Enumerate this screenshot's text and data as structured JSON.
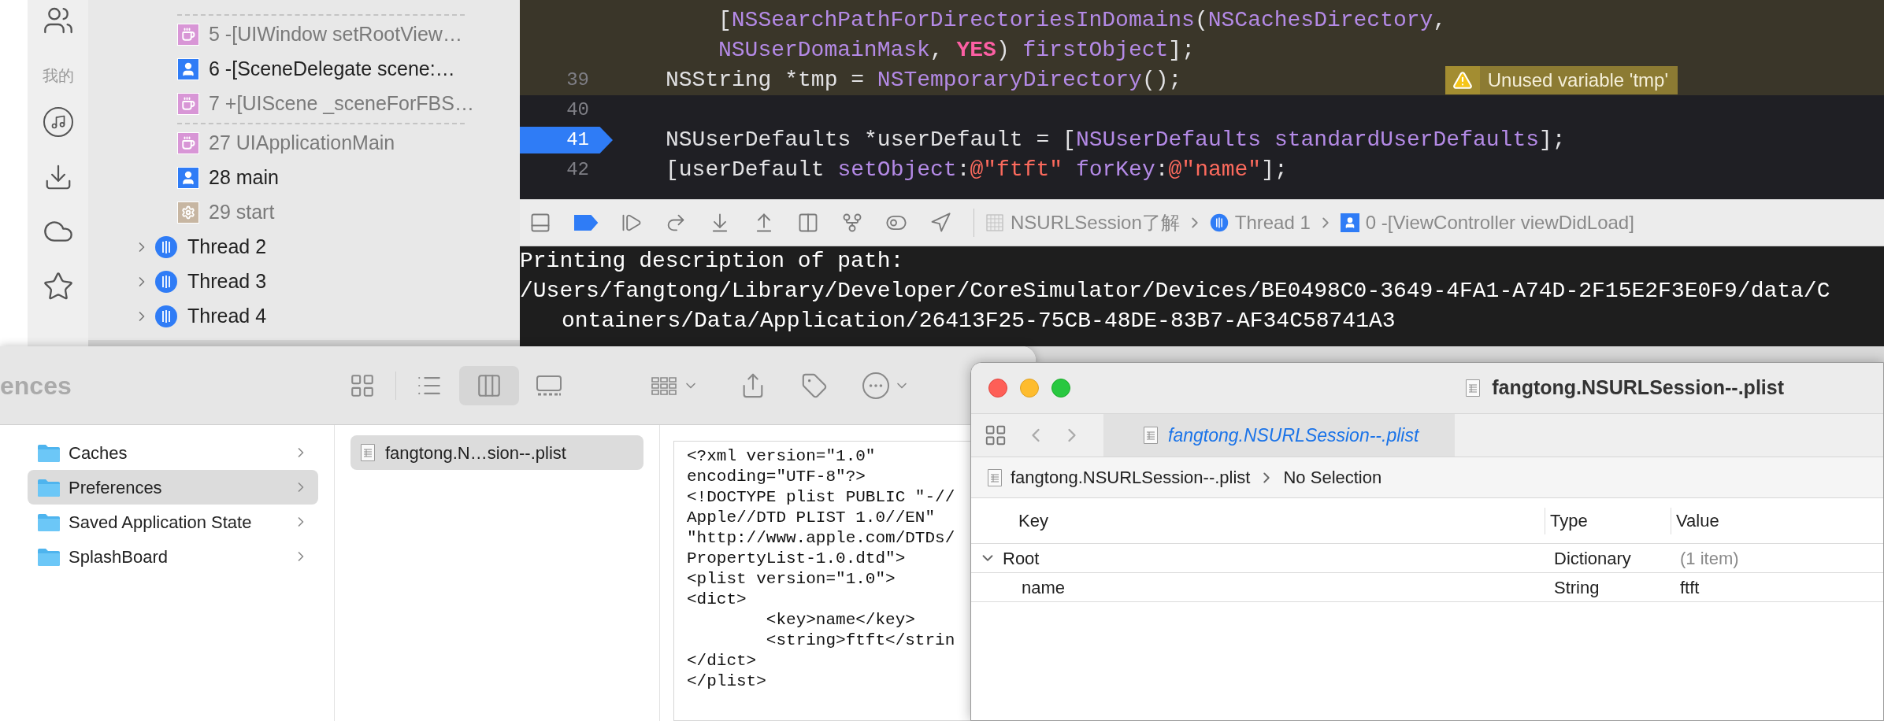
{
  "music_sidebar": {
    "label": "我的"
  },
  "debug_navigator": {
    "frames": [
      {
        "number": "5",
        "text": "-[UIWindow setRootView…",
        "kind": "system",
        "divider_before": true
      },
      {
        "number": "6",
        "text": "-[SceneDelegate scene:…",
        "kind": "user",
        "divider_before": false
      },
      {
        "number": "7",
        "text": "+[UIScene _sceneForFBS…",
        "kind": "system",
        "divider_before": false
      },
      {
        "number": "27",
        "text": "UIApplicationMain",
        "kind": "system",
        "divider_before": true
      },
      {
        "number": "28",
        "text": "main",
        "kind": "user",
        "divider_before": false
      },
      {
        "number": "29",
        "text": "start",
        "kind": "runtime",
        "divider_before": false
      }
    ],
    "threads": [
      {
        "label": "Thread 2",
        "expanded": false
      },
      {
        "label": "Thread 3",
        "expanded": false
      },
      {
        "label": "Thread 4",
        "expanded": false
      }
    ]
  },
  "code": {
    "lines": [
      {
        "highlighted": true,
        "kind": "wrapped",
        "tokens": [
          {
            "text": "[",
            "kind": "plain"
          },
          {
            "text": "NSSearchPathForDirectoriesInDomains",
            "kind": "func"
          },
          {
            "text": "(",
            "kind": "plain"
          },
          {
            "text": "NSCachesDirectory",
            "kind": "func"
          },
          {
            "text": ",",
            "kind": "plain"
          }
        ]
      },
      {
        "highlighted": true,
        "kind": "wrapped",
        "tokens": [
          {
            "text": "NSUserDomainMask",
            "kind": "func"
          },
          {
            "text": ", ",
            "kind": "plain"
          },
          {
            "text": "YES",
            "kind": "keyword"
          },
          {
            "text": ") ",
            "kind": "plain"
          },
          {
            "text": "firstObject",
            "kind": "func"
          },
          {
            "text": "];",
            "kind": "plain"
          }
        ]
      },
      {
        "number": "39",
        "highlighted": true,
        "breakpoint": false,
        "kind": "statement",
        "warning": "Unused variable 'tmp'",
        "tokens": [
          {
            "text": "NSString *tmp = ",
            "kind": "plain"
          },
          {
            "text": "NSTemporaryDirectory",
            "kind": "func"
          },
          {
            "text": "();",
            "kind": "plain"
          }
        ]
      },
      {
        "number": "40",
        "highlighted": false,
        "breakpoint": false
      },
      {
        "number": "41",
        "highlighted": false,
        "breakpoint": true,
        "kind": "statement",
        "tokens": [
          {
            "text": "NSUserDefaults *userDefault = [",
            "kind": "plain"
          },
          {
            "text": "NSUserDefaults ",
            "kind": "func"
          },
          {
            "text": "standardUserDefaults",
            "kind": "func"
          },
          {
            "text": "];",
            "kind": "plain"
          }
        ]
      },
      {
        "number": "42",
        "highlighted": false,
        "breakpoint": false,
        "kind": "statement",
        "tokens": [
          {
            "text": "[userDefault ",
            "kind": "plain"
          },
          {
            "text": "setObject",
            "kind": "func"
          },
          {
            "text": ":",
            "kind": "plain"
          },
          {
            "text": "@\"ftft\" ",
            "kind": "string"
          },
          {
            "text": "forKey",
            "kind": "func"
          },
          {
            "text": ":",
            "kind": "plain"
          },
          {
            "text": "@\"name\"",
            "kind": "string"
          },
          {
            "text": "];",
            "kind": "plain"
          }
        ]
      }
    ]
  },
  "debug_bar": {
    "breakpoints_active": true,
    "breadcrumb": [
      {
        "text": "NSURLSession了解",
        "kind": "project"
      },
      {
        "text": "Thread 1",
        "kind": "thread"
      },
      {
        "text": "0 -[ViewController viewDidLoad]",
        "kind": "frame"
      }
    ]
  },
  "console": {
    "lines": [
      {
        "text": "Printing description of path:",
        "continuation": false
      },
      {
        "text": "/Users/fangtong/Library/Developer/CoreSimulator/Devices/BE0498C0-3649-4FA1-A74D-2F15E2F3E0F9/data/C",
        "continuation": false
      },
      {
        "text": "ontainers/Data/Application/26413F25-75CB-48DE-83B7-AF34C58741A3",
        "continuation": true
      }
    ]
  },
  "finder": {
    "title": "ences",
    "view_modes": [
      {
        "kind": "icons",
        "selected": false
      },
      {
        "kind": "list",
        "selected": false
      },
      {
        "kind": "columns",
        "selected": true
      },
      {
        "kind": "gallery",
        "selected": false
      }
    ],
    "folders": [
      {
        "name": "Caches",
        "selected": false
      },
      {
        "name": "Preferences",
        "selected": true
      },
      {
        "name": "Saved Application State",
        "selected": false
      },
      {
        "name": "SplashBoard",
        "selected": false
      }
    ],
    "files": [
      {
        "name": "fangtong.N…sion--.plist",
        "selected": true
      }
    ],
    "preview": [
      "<?xml version=\"1.0\"",
      "encoding=\"UTF-8\"?>",
      "<!DOCTYPE plist PUBLIC \"-//",
      "Apple//DTD PLIST 1.0//EN\"",
      "\"http://www.apple.com/DTDs/",
      "PropertyList-1.0.dtd\">",
      "<plist version=\"1.0\">",
      "<dict>",
      "\t<key>name</key>",
      "\t<string>ftft</strin",
      "</dict>",
      "</plist>"
    ]
  },
  "plist_editor": {
    "title": "fangtong.NSURLSession--.plist",
    "tab": "fangtong.NSURLSession--.plist",
    "path": [
      "fangtong.NSURLSession--.plist",
      "No Selection"
    ],
    "columns": [
      "Key",
      "Type",
      "Value"
    ],
    "rows": [
      {
        "key": "Root",
        "type": "Dictionary",
        "value": "(1 item)",
        "expanded": true,
        "children": [
          {
            "key": "name",
            "type": "String",
            "value": "ftft"
          }
        ]
      }
    ]
  }
}
